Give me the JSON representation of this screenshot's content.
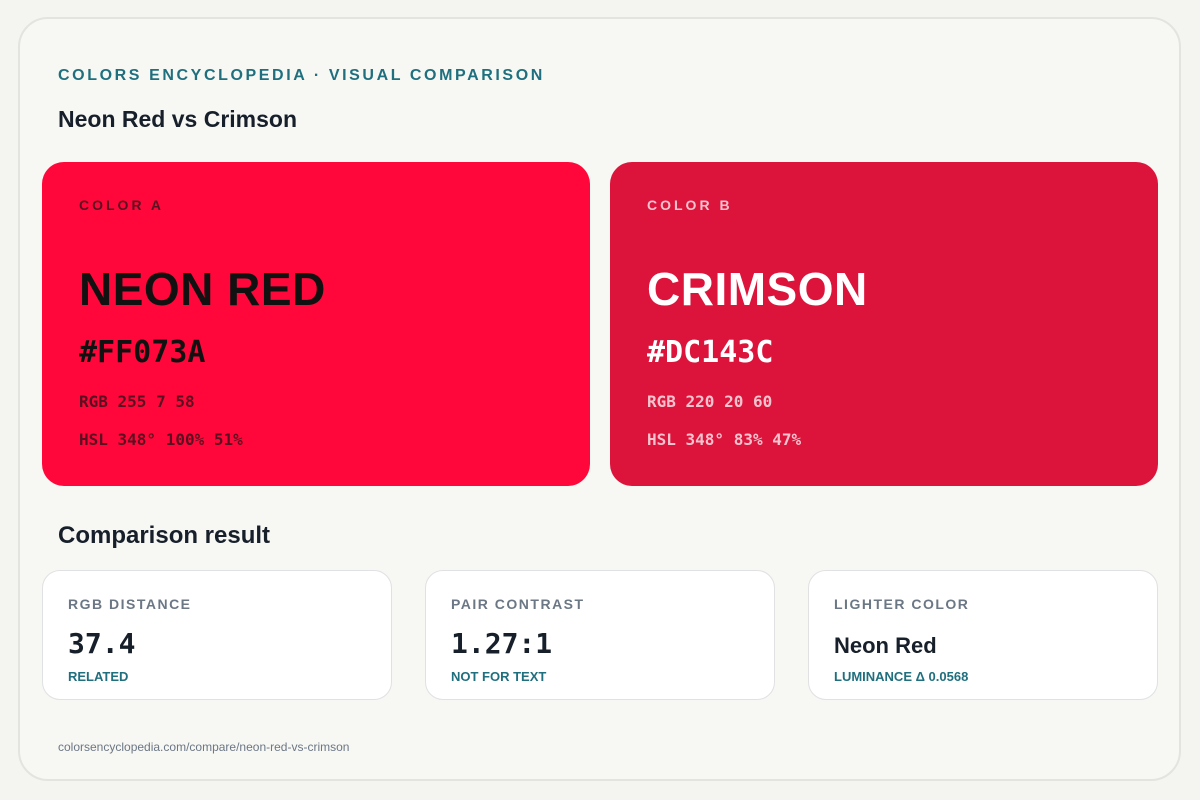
{
  "header": {
    "eyebrow": "COLORS ENCYCLOPEDIA · VISUAL COMPARISON",
    "title": "Neon Red vs Crimson"
  },
  "colors": [
    {
      "slot": "COLOR A",
      "name": "NEON RED",
      "hex": "#FF073A",
      "rgb": "RGB 255 7 58",
      "hsl": "HSL 348° 100% 51%",
      "background": "#FF073A",
      "name_color": "#111111",
      "hex_color": "#111111",
      "meta_color": "#5a1020"
    },
    {
      "slot": "COLOR B",
      "name": "CRIMSON",
      "hex": "#DC143C",
      "rgb": "RGB 220 20 60",
      "hsl": "HSL 348° 83% 47%",
      "background": "#DC143C",
      "name_color": "#ffffff",
      "hex_color": "#ffffff",
      "meta_color": "#f4c3cd"
    }
  ],
  "comparison": {
    "title": "Comparison result",
    "cards": [
      {
        "label": "RGB DISTANCE",
        "value": "37.4",
        "note": "RELATED"
      },
      {
        "label": "PAIR CONTRAST",
        "value": "1.27:1",
        "note": "NOT FOR TEXT"
      },
      {
        "label": "LIGHTER COLOR",
        "value": "Neon Red",
        "note": "LUMINANCE Δ 0.0568"
      }
    ]
  },
  "footer": {
    "url": "colorsencyclopedia.com/compare/neon-red-vs-crimson"
  },
  "theme": {
    "accent": "#1f6f7e",
    "text": "#17202a",
    "muted": "#6b7785"
  }
}
